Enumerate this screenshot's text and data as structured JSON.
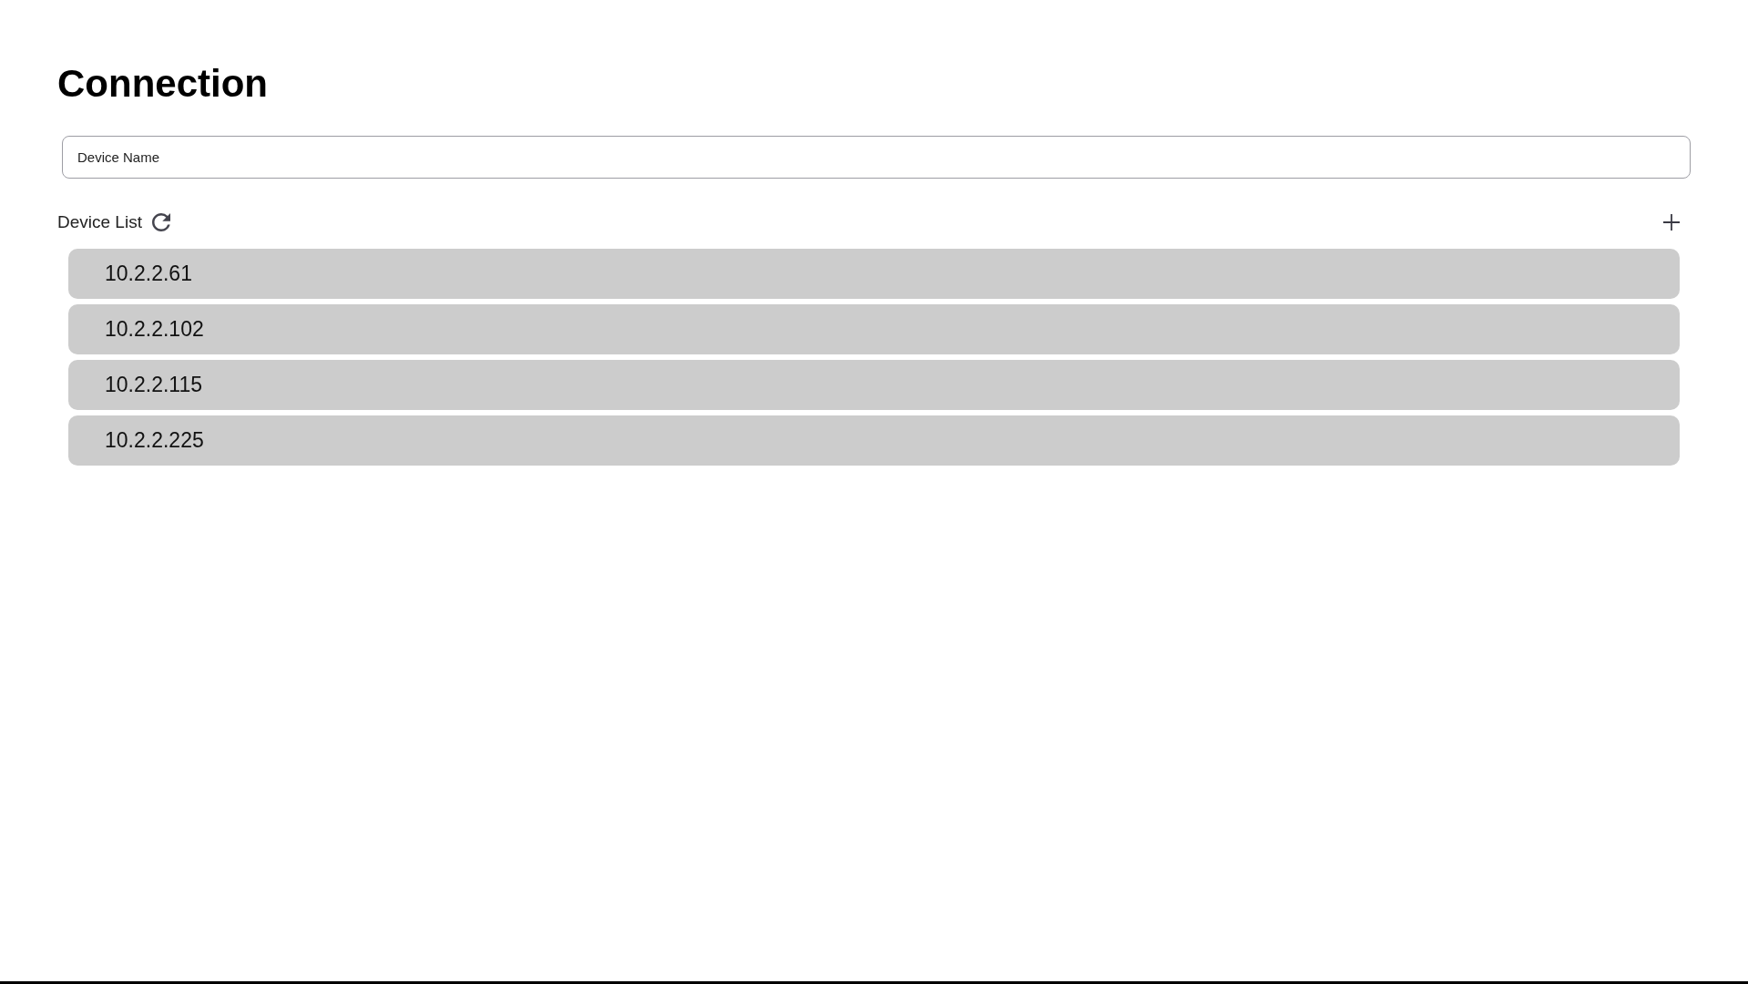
{
  "title": "Connection",
  "device_name_field": {
    "placeholder": "Device Name"
  },
  "device_list": {
    "label": "Device List",
    "devices": [
      {
        "address": "10.2.2.61"
      },
      {
        "address": "10.2.2.102"
      },
      {
        "address": "10.2.2.115"
      },
      {
        "address": "10.2.2.225"
      }
    ]
  }
}
